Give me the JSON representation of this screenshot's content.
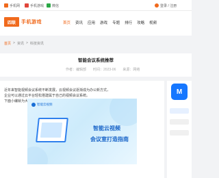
{
  "topbar": {
    "items": [
      {
        "label": "手机网",
        "color": "#f06a1d"
      },
      {
        "label": "手机游戏",
        "color": "#e0463a"
      },
      {
        "label": "微信",
        "color": "#2aa845"
      }
    ],
    "right_label": "登录 / 注册"
  },
  "header": {
    "logo_mark": "四联",
    "logo_name": "手机游戏",
    "nav": [
      "首页",
      "资讯",
      "应用",
      "游戏",
      "专题",
      "排行",
      "攻略",
      "视频"
    ]
  },
  "breadcrumb": [
    "首页",
    ">",
    "资讯",
    ">",
    "科技资讯"
  ],
  "article": {
    "title": "智能会议系统推荐",
    "meta": [
      "作者：编辑部",
      "时间：2023-06",
      "来源：网络"
    ]
  },
  "content": {
    "paragraphs": [
      "近年来智能视频会议系统不断发展，云视频会议逐渐成为办公新方式，",
      "企业可以通过云平台轻松搭建属于自己的视频会议系统。",
      "下面小编就为大家带来详细介绍，一起来看看吧。"
    ],
    "hero": {
      "tag": "智能云视频",
      "headline1": "智能云视频",
      "headline2": "会议室打造指南"
    }
  },
  "sidebar": {
    "app_icon_letter": "M"
  }
}
